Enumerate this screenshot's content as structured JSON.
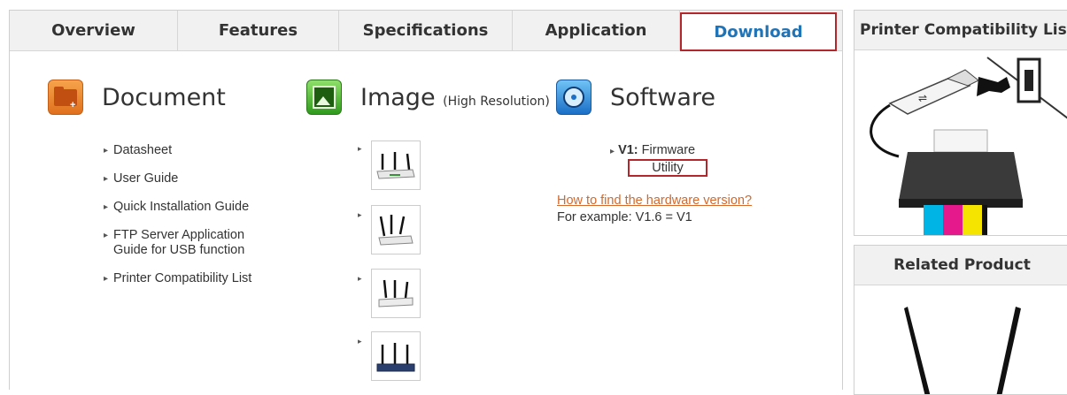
{
  "tabs": [
    "Overview",
    "Features",
    "Specifications",
    "Application",
    "Download"
  ],
  "document": {
    "title": "Document",
    "items": [
      "Datasheet",
      "User Guide",
      "Quick Installation Guide",
      "FTP Server Application Guide for USB function",
      "Printer Compatibility List"
    ]
  },
  "image": {
    "title": "Image",
    "subtitle": "(High Resolution)"
  },
  "software": {
    "title": "Software",
    "version_label": "V1:",
    "firmware": "Firmware",
    "utility": "Utility",
    "hw_link": "How to find the hardware version?",
    "example": "For example: V1.6 = V1"
  },
  "sidebar": {
    "printer_title": "Printer Compatibility List",
    "related_title": "Related Product"
  },
  "colors": {
    "accent": "#1f73b7",
    "highlight_border": "#b3262b",
    "link_orange": "#d5682a"
  }
}
